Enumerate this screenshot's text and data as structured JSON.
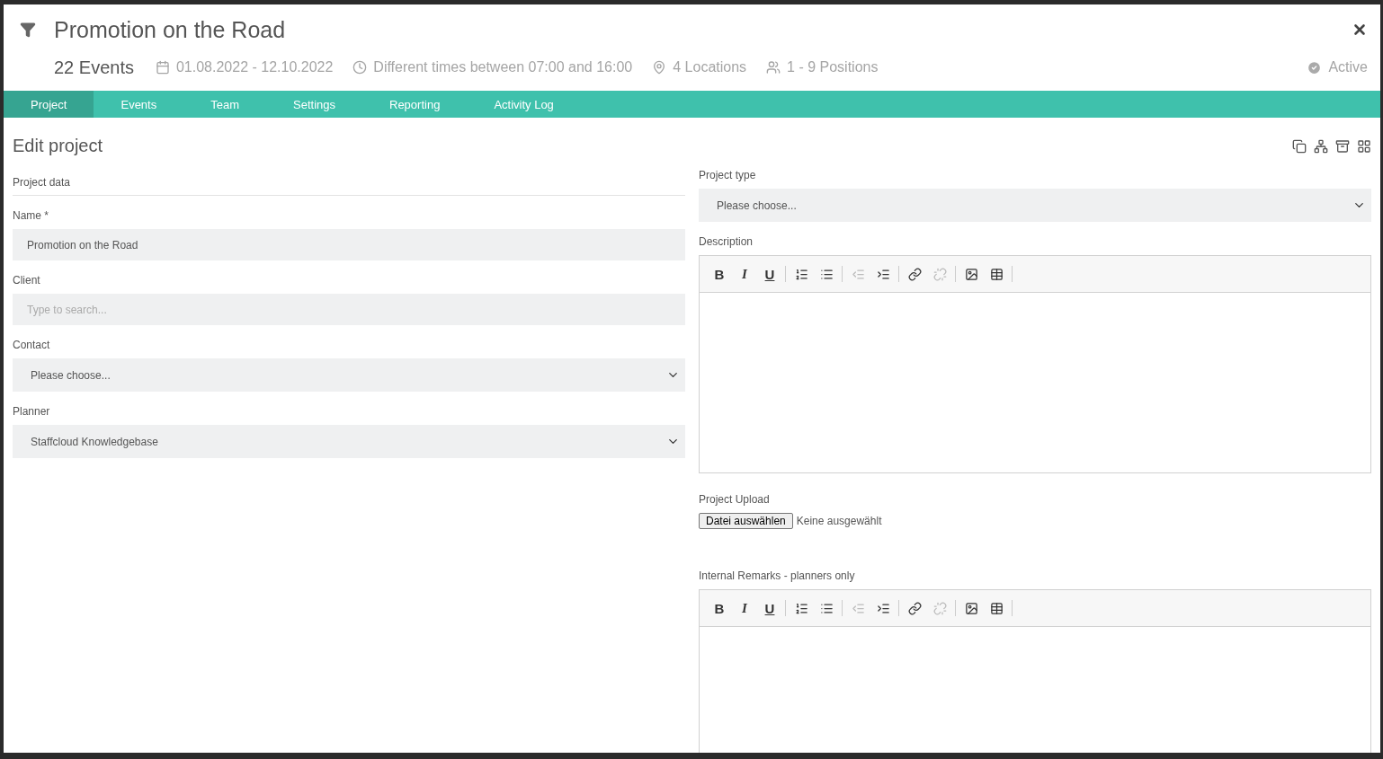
{
  "header": {
    "title": "Promotion on the Road",
    "events": "22 Events",
    "status": {
      "label": "Active",
      "active": true
    },
    "meta": [
      {
        "kind": "calendar",
        "text": "01.08.2022 - 12.10.2022"
      },
      {
        "kind": "clock",
        "text": "Different times between 07:00 and 16:00"
      },
      {
        "kind": "pin",
        "text": "4 Locations"
      },
      {
        "kind": "people",
        "text": "1 - 9 Positions"
      }
    ]
  },
  "tabs": [
    {
      "label": "Project",
      "selected": true
    },
    {
      "label": "Events",
      "selected": false
    },
    {
      "label": "Team",
      "selected": false
    },
    {
      "label": "Settings",
      "selected": false
    },
    {
      "label": "Reporting",
      "selected": false
    },
    {
      "label": "Activity Log",
      "selected": false
    }
  ],
  "page_title": "Edit project",
  "left": {
    "section": "Project data",
    "fields": [
      {
        "kind": "input",
        "label": "Name *",
        "value": "Promotion on the Road"
      },
      {
        "kind": "input",
        "label": "Client",
        "placeholder": "Type to search..."
      },
      {
        "kind": "select",
        "label": "Contact",
        "value": "Please choose..."
      },
      {
        "kind": "select",
        "label": "Planner",
        "value": "Staffcloud Knowledgebase"
      }
    ]
  },
  "right": {
    "project_type": {
      "label": "Project type",
      "value": "Please choose..."
    },
    "editors": [
      {
        "label": "Description",
        "toolbar": [
          {
            "kind": "bold",
            "label": "B",
            "disabled": false
          },
          {
            "kind": "italic",
            "label": "I",
            "disabled": false
          },
          {
            "kind": "underline",
            "label": "U",
            "disabled": false
          },
          {
            "kind": "sep"
          },
          {
            "kind": "ol",
            "disabled": false
          },
          {
            "kind": "ul",
            "disabled": false
          },
          {
            "kind": "sep"
          },
          {
            "kind": "outdent",
            "disabled": true
          },
          {
            "kind": "indent",
            "disabled": false
          },
          {
            "kind": "sep"
          },
          {
            "kind": "link",
            "disabled": false
          },
          {
            "kind": "unlink",
            "disabled": true
          },
          {
            "kind": "sep"
          },
          {
            "kind": "image",
            "disabled": false
          },
          {
            "kind": "table",
            "disabled": false
          },
          {
            "kind": "sep"
          }
        ]
      },
      {
        "label": "Internal Remarks - planners only",
        "toolbar": [
          {
            "kind": "bold",
            "label": "B",
            "disabled": false
          },
          {
            "kind": "italic",
            "label": "I",
            "disabled": false
          },
          {
            "kind": "underline",
            "label": "U",
            "disabled": false
          },
          {
            "kind": "sep"
          },
          {
            "kind": "ol",
            "disabled": false
          },
          {
            "kind": "ul",
            "disabled": false
          },
          {
            "kind": "sep"
          },
          {
            "kind": "outdent",
            "disabled": true
          },
          {
            "kind": "indent",
            "disabled": false
          },
          {
            "kind": "sep"
          },
          {
            "kind": "link",
            "disabled": false
          },
          {
            "kind": "unlink",
            "disabled": true
          },
          {
            "kind": "sep"
          },
          {
            "kind": "image",
            "disabled": false
          },
          {
            "kind": "table",
            "disabled": false
          },
          {
            "kind": "sep"
          }
        ]
      }
    ],
    "upload": {
      "label": "Project Upload",
      "button": "Datei auswählen",
      "status": "Keine ausgewählt"
    }
  }
}
